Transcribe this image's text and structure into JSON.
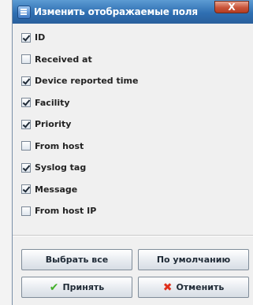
{
  "dialog": {
    "title": "Изменить отображаемые поля",
    "close_glyph": "X"
  },
  "fields": [
    {
      "label": "ID",
      "checked": true
    },
    {
      "label": "Received at",
      "checked": false
    },
    {
      "label": "Device reported time",
      "checked": true
    },
    {
      "label": "Facility",
      "checked": true
    },
    {
      "label": "Priority",
      "checked": true
    },
    {
      "label": "From host",
      "checked": false
    },
    {
      "label": "Syslog tag",
      "checked": true
    },
    {
      "label": "Message",
      "checked": true
    },
    {
      "label": "From host IP",
      "checked": false
    }
  ],
  "buttons": {
    "select_all": "Выбрать все",
    "defaults": "По умолчанию",
    "accept": "Принять",
    "cancel": "Отменить"
  },
  "icons": {
    "accept": "check-icon",
    "cancel": "cross-icon"
  },
  "colors": {
    "titlebar": "#2f6fb2",
    "accept_icon": "#43b02a",
    "cancel_icon": "#e0311d"
  }
}
